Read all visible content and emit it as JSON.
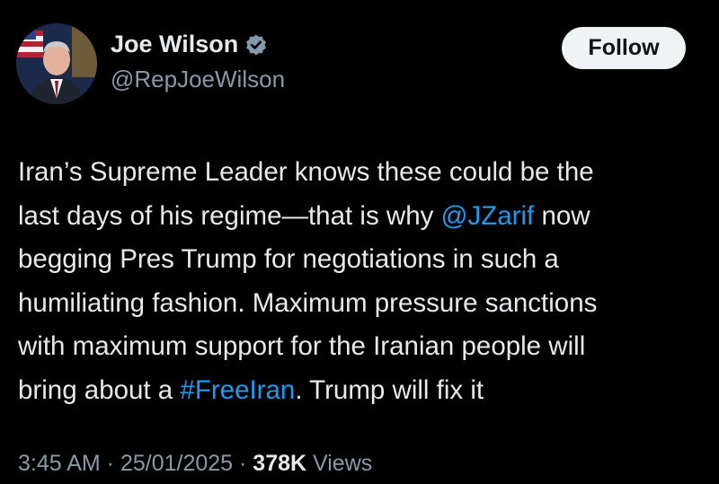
{
  "author": {
    "name": "Joe Wilson",
    "handle": "@RepJoeWilson",
    "verified_icon": "verified-badge-icon",
    "avatar": "profile-photo"
  },
  "follow_button": {
    "label": "Follow"
  },
  "tweet": {
    "lines": [
      [
        {
          "text": "Iran’s Supreme Leader knows these could be the",
          "link": false
        }
      ],
      [
        {
          "text": "last days of his regime—that is why ",
          "link": false
        },
        {
          "text": "@JZarif",
          "link": true
        },
        {
          "text": " now",
          "link": false
        }
      ],
      [
        {
          "text": "begging Pres Trump for negotiations in such a",
          "link": false
        }
      ],
      [
        {
          "text": "humiliating fashion. Maximum pressure sanctions",
          "link": false
        }
      ],
      [
        {
          "text": "with maximum support for the Iranian people will",
          "link": false
        }
      ],
      [
        {
          "text": "bring about a ",
          "link": false
        },
        {
          "text": "#FreeIran",
          "link": true
        },
        {
          "text": ". Trump will fix it",
          "link": false
        }
      ]
    ]
  },
  "meta": {
    "time": "3:45 AM",
    "separator": " · ",
    "date": "25/01/2025",
    "views_count": "378K",
    "views_label": " Views"
  },
  "colors": {
    "background": "#000000",
    "text": "#e7e9ea",
    "secondary": "#8b98a5",
    "link": "#1d9bf0",
    "button_bg": "#eff3f4"
  }
}
